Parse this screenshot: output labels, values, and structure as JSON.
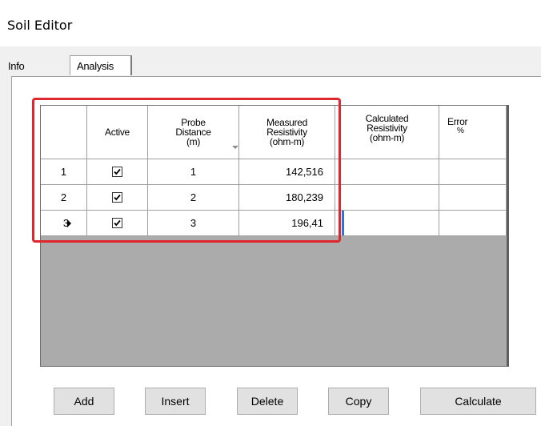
{
  "window": {
    "title": "Soil Editor"
  },
  "tabs": [
    {
      "label": "Info"
    },
    {
      "label": "Analysis"
    }
  ],
  "grid": {
    "headers": {
      "active": "Active",
      "probe": [
        "Probe",
        "Distance",
        "(m)"
      ],
      "measured": [
        "Measured",
        "Resistivity",
        "(ohm-m)"
      ],
      "calculated": [
        "Calculated",
        "Resistivity",
        "(ohm-m)"
      ],
      "error": [
        "Error",
        "%"
      ]
    },
    "rows": [
      {
        "num": "1",
        "active": true,
        "distance": "1",
        "measured": "142,516",
        "calculated": "",
        "error": ""
      },
      {
        "num": "2",
        "active": true,
        "distance": "2",
        "measured": "180,239",
        "calculated": "",
        "error": ""
      },
      {
        "num": "3",
        "active": true,
        "distance": "3",
        "measured": "196,41",
        "calculated": "",
        "error": ""
      }
    ]
  },
  "buttons": {
    "add": "Add",
    "insert": "Insert",
    "delete": "Delete",
    "copy": "Copy",
    "calculate": "Calculate"
  },
  "colors": {
    "highlight": "#e0262f",
    "cursor": "#2f72d8"
  }
}
